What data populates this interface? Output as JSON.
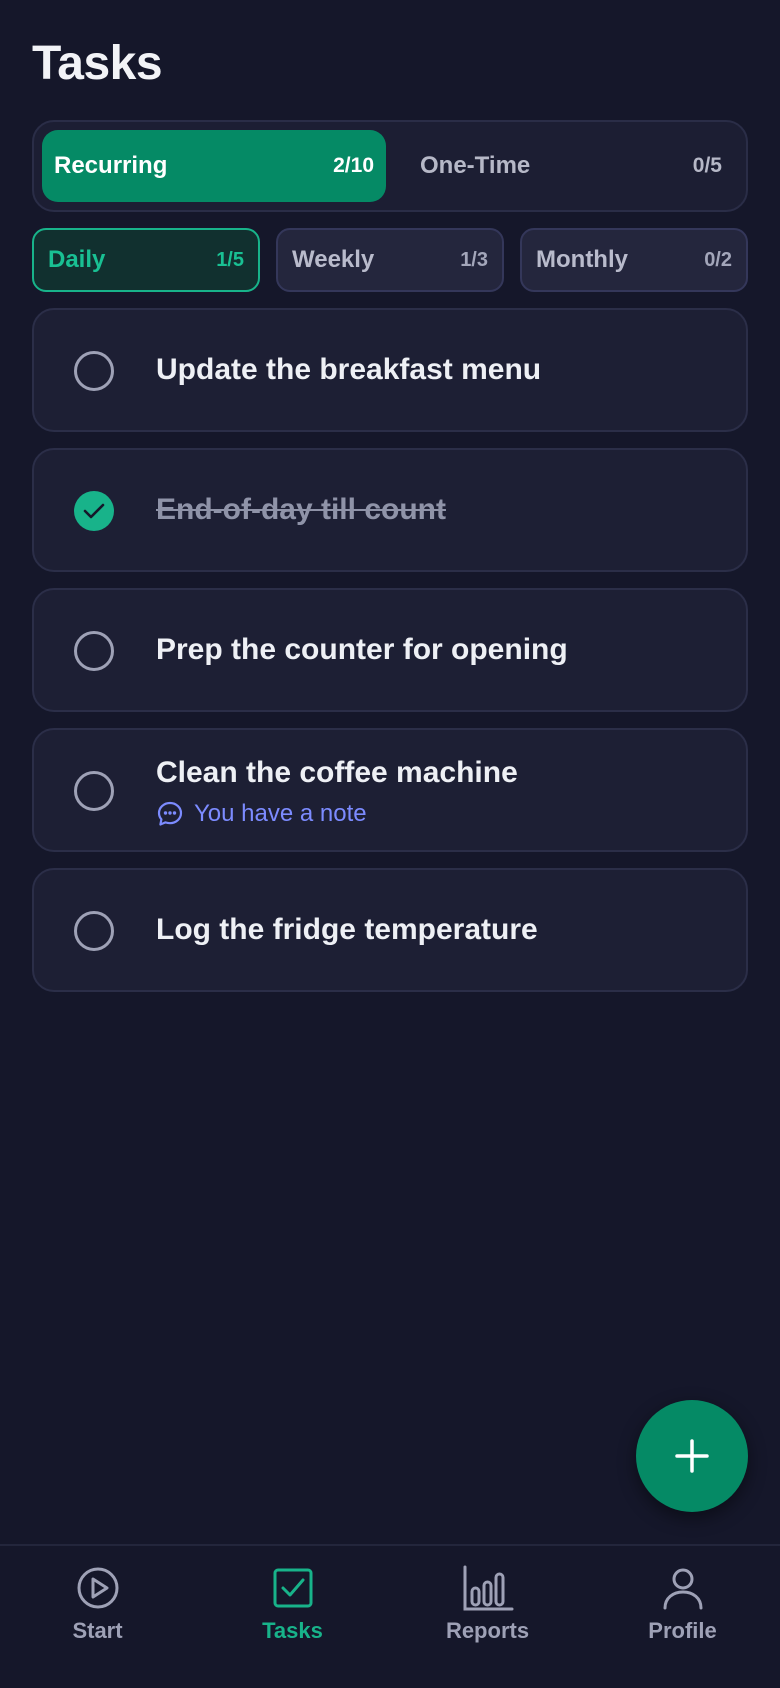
{
  "header": {
    "title": "Tasks"
  },
  "segments": [
    {
      "label": "Recurring",
      "count": "2/10",
      "active": true
    },
    {
      "label": "One-Time",
      "count": "0/5",
      "active": false
    }
  ],
  "filters": [
    {
      "label": "Daily",
      "count": "1/5",
      "active": true
    },
    {
      "label": "Weekly",
      "count": "1/3",
      "active": false
    },
    {
      "label": "Monthly",
      "count": "0/2",
      "active": false
    }
  ],
  "tasks": [
    {
      "title": "Update the breakfast menu",
      "done": false
    },
    {
      "title": "End-of-day till count",
      "done": true
    },
    {
      "title": "Prep the counter for opening",
      "done": false
    },
    {
      "title": "Clean the coffee machine",
      "done": false,
      "note": "You have a note"
    },
    {
      "title": "Log the fridge temperature",
      "done": false
    }
  ],
  "fab": {
    "icon": "plus-icon"
  },
  "nav": [
    {
      "label": "Start",
      "icon": "play-icon",
      "active": false
    },
    {
      "label": "Tasks",
      "icon": "checkbox-icon",
      "active": true
    },
    {
      "label": "Reports",
      "icon": "bar-chart-icon",
      "active": false
    },
    {
      "label": "Profile",
      "icon": "user-icon",
      "active": false
    }
  ],
  "colors": {
    "background": "#15172a",
    "accent": "#058a65",
    "accent_light": "#18b38a",
    "note": "#7c8bff"
  }
}
